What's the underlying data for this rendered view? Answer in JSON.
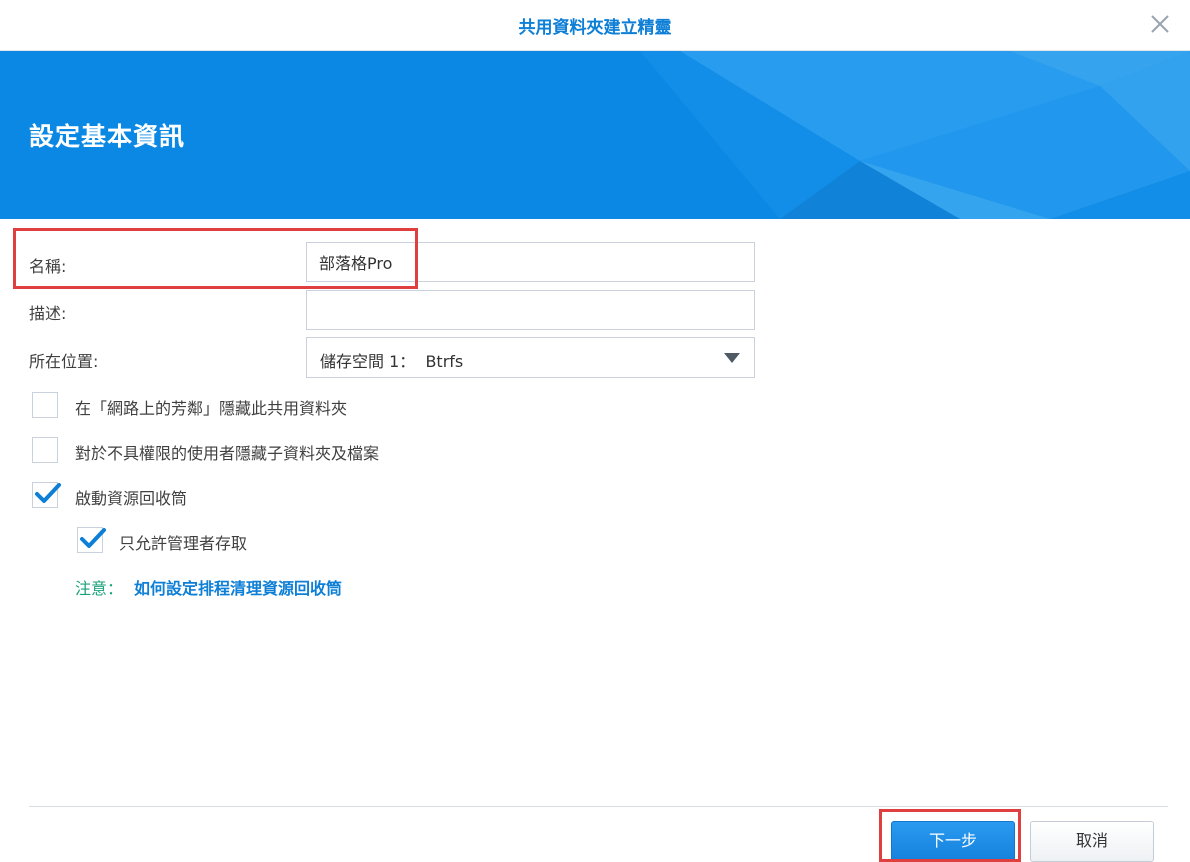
{
  "window": {
    "title": "共用資料夾建立精靈",
    "close_icon": "close-icon"
  },
  "banner": {
    "heading": "設定基本資訊",
    "color": "#0a88e4"
  },
  "form": {
    "name_label": "名稱:",
    "name_value": "部落格Pro",
    "description_label": "描述:",
    "description_value": "",
    "location_label": "所在位置:",
    "location_value": "儲存空間 1：  Btrfs"
  },
  "options": {
    "hide_network": {
      "label": "在「網路上的芳鄰」隱藏此共用資料夾",
      "checked": false
    },
    "hide_subfolders": {
      "label": "對於不具權限的使用者隱藏子資料夾及檔案",
      "checked": false
    },
    "recycle_bin": {
      "label": "啟動資源回收筒",
      "checked": true
    },
    "admin_only": {
      "label": "只允許管理者存取",
      "checked": true
    }
  },
  "note": {
    "prefix": "注意：",
    "link": "如何設定排程清理資源回收筒"
  },
  "footer": {
    "next_label": "下一步",
    "cancel_label": "取消"
  },
  "colors": {
    "accent": "#0e7fd6",
    "note_green": "#1aa27a",
    "highlight": "#e03f3f"
  }
}
